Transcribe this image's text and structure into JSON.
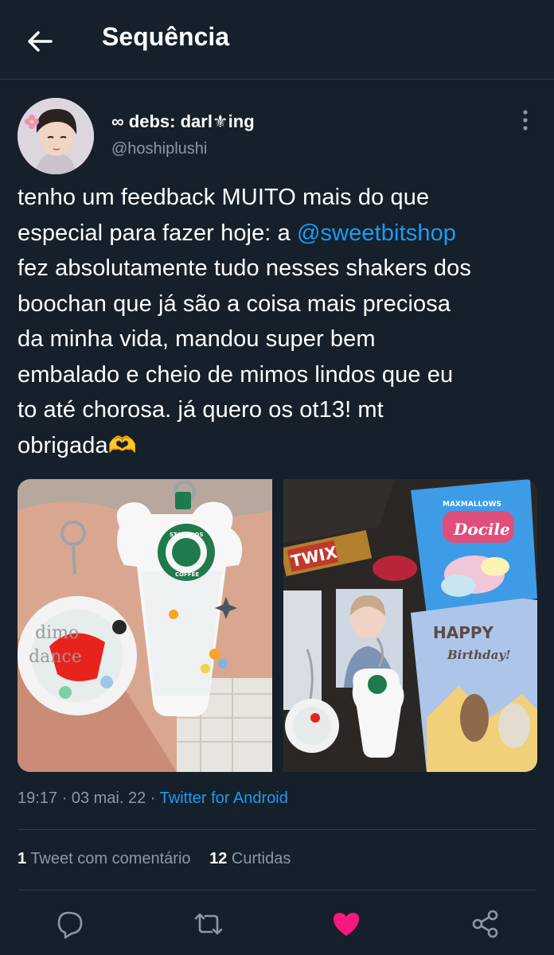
{
  "header": {
    "title": "Sequência",
    "back_icon": "arrow-left-icon"
  },
  "author": {
    "display_name": "∞ debs: darl⚜ing",
    "handle": "@hoshiplushi"
  },
  "tweet": {
    "lines": [
      {
        "pre": "tenho um feedback MUITO mais do que",
        "mention": "",
        "post": ""
      },
      {
        "pre": "especial para fazer hoje: a ",
        "mention": "@sweetbitshop",
        "post": ""
      },
      {
        "pre": "fez absolutamente tudo nesses shakers dos",
        "mention": "",
        "post": ""
      },
      {
        "pre": "boochan que já são a coisa mais preciosa",
        "mention": "",
        "post": ""
      },
      {
        "pre": "da minha vida, mandou super bem",
        "mention": "",
        "post": ""
      },
      {
        "pre": "embalado e cheio de mimos lindos que eu",
        "mention": "",
        "post": ""
      },
      {
        "pre": "to até chorosa. já quero os ot13! mt",
        "mention": "",
        "post": ""
      },
      {
        "pre": "obrigada🫶",
        "mention": "",
        "post": ""
      }
    ]
  },
  "media": {
    "left": {
      "badge": "STARBOOS",
      "badge_bottom": "COFFEE",
      "charm_text_1": "dimo",
      "charm_text_2": "dance"
    },
    "right": {
      "candy": "TWIX",
      "bag": "Docile",
      "bag_top": "MAXMALLOWS",
      "card_line_1": "HAPPY",
      "card_line_2": "Birthday!"
    }
  },
  "meta": {
    "time": "19:17",
    "sep1": " · ",
    "date": "03 mai. 22",
    "sep2": " · ",
    "app": "Twitter for Android"
  },
  "stats": {
    "quotes_count": "1",
    "quotes_label": " Tweet com comentário",
    "likes_count": "12",
    "likes_label": " Curtidas"
  },
  "actions": {
    "reply_icon": "reply-icon",
    "retweet_icon": "retweet-icon",
    "like_icon": "heart-icon",
    "share_icon": "share-icon",
    "like_color": "#f91880"
  },
  "colors": {
    "background": "#15202b",
    "accent": "#1d9bf0",
    "secondary_text": "#8b98a5"
  }
}
